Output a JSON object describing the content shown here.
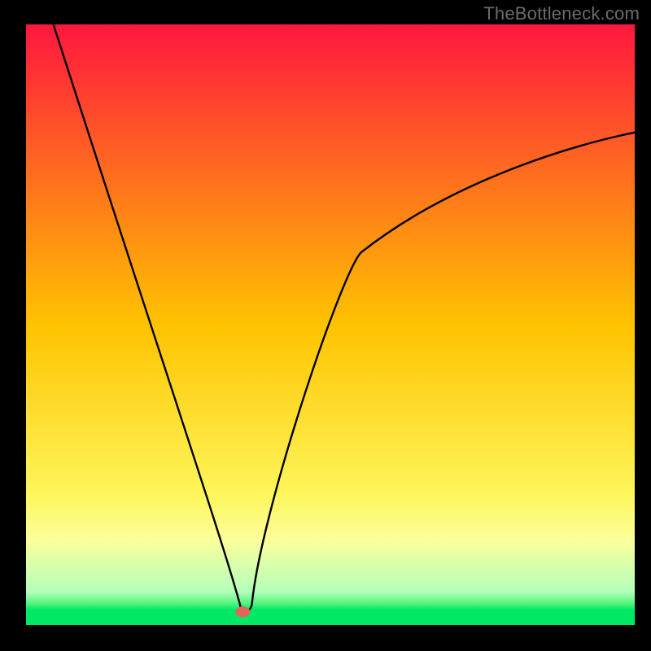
{
  "watermark": "TheBottleneck.com",
  "chart_data": {
    "type": "line",
    "title": "",
    "xlabel": "",
    "ylabel": "",
    "xlim": [
      0,
      100
    ],
    "ylim": [
      0,
      100
    ],
    "background_gradient": {
      "stops": [
        {
          "offset": 0.0,
          "color": "#ff173e"
        },
        {
          "offset": 0.5,
          "color": "#ffc300"
        },
        {
          "offset": 0.78,
          "color": "#fdf559"
        },
        {
          "offset": 0.86,
          "color": "#fbff9c"
        },
        {
          "offset": 0.945,
          "color": "#b3ffba"
        },
        {
          "offset": 0.963,
          "color": "#59f57f"
        },
        {
          "offset": 0.975,
          "color": "#00e864"
        },
        {
          "offset": 1.0,
          "color": "#00e864"
        }
      ]
    },
    "curve": {
      "left_start": {
        "x": 4.5,
        "y": 100
      },
      "dip": {
        "x": 35.5,
        "y": 2.0
      },
      "right_end": {
        "x": 100,
        "y": 82
      },
      "left_slope_at_dip_deg": 74,
      "right_initial_slope_deg": 80,
      "right_end_slope_deg": 8
    },
    "marker": {
      "x": 35.6,
      "y": 2.2,
      "rx": 1.2,
      "ry": 0.9,
      "color": "#e06655"
    },
    "colors": {
      "frame": "#000000",
      "curve": "#000000"
    }
  }
}
